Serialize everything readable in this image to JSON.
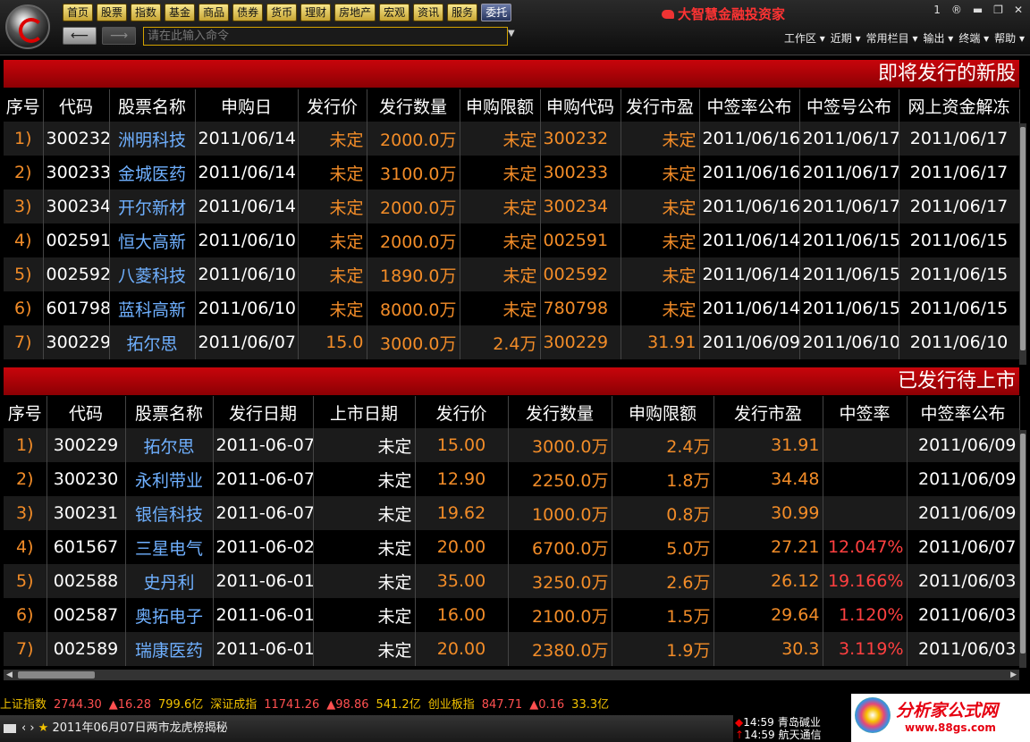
{
  "menubar": {
    "items": [
      "首页",
      "股票",
      "指数",
      "基金",
      "商品",
      "债券",
      "货币",
      "理财",
      "房地产",
      "宏观",
      "资讯",
      "服务",
      "委托"
    ],
    "selected_index": 12
  },
  "brand": "大智慧金融投资家",
  "window": {
    "pin": "1",
    "reg": "®",
    "min": "▬",
    "max": "❐",
    "close": "✕"
  },
  "nav": {
    "back": "⟵",
    "forward": "⟶"
  },
  "command": {
    "placeholder": "请在此输入命令",
    "dropdown": "▼"
  },
  "right_menu": [
    "工作区 ▾",
    "近期 ▾",
    "常用栏目 ▾",
    "输出 ▾",
    "终端 ▾",
    "帮助 ▾"
  ],
  "section1": {
    "title": "即将发行的新股",
    "headers": [
      "序号",
      "代码",
      "股票名称",
      "申购日",
      "发行价",
      "发行数量",
      "申购限额",
      "申购代码",
      "发行市盈",
      "中签率公布",
      "中签号公布",
      "网上资金解冻"
    ],
    "rows": [
      [
        "1)",
        "300232",
        "洲明科技",
        "2011/06/14",
        "未定",
        "2000.0万",
        "未定",
        "300232",
        "未定",
        "2011/06/16",
        "2011/06/17",
        "2011/06/17"
      ],
      [
        "2)",
        "300233",
        "金城医药",
        "2011/06/14",
        "未定",
        "3100.0万",
        "未定",
        "300233",
        "未定",
        "2011/06/16",
        "2011/06/17",
        "2011/06/17"
      ],
      [
        "3)",
        "300234",
        "开尔新材",
        "2011/06/14",
        "未定",
        "2000.0万",
        "未定",
        "300234",
        "未定",
        "2011/06/16",
        "2011/06/17",
        "2011/06/17"
      ],
      [
        "4)",
        "002591",
        "恒大高新",
        "2011/06/10",
        "未定",
        "2000.0万",
        "未定",
        "002591",
        "未定",
        "2011/06/14",
        "2011/06/15",
        "2011/06/15"
      ],
      [
        "5)",
        "002592",
        "八菱科技",
        "2011/06/10",
        "未定",
        "1890.0万",
        "未定",
        "002592",
        "未定",
        "2011/06/14",
        "2011/06/15",
        "2011/06/15"
      ],
      [
        "6)",
        "601798",
        "蓝科高新",
        "2011/06/10",
        "未定",
        "8000.0万",
        "未定",
        "780798",
        "未定",
        "2011/06/14",
        "2011/06/15",
        "2011/06/15"
      ],
      [
        "7)",
        "300229",
        "拓尔思",
        "2011/06/07",
        "15.0",
        "3000.0万",
        "2.4万",
        "300229",
        "31.91",
        "2011/06/09",
        "2011/06/10",
        "2011/06/10"
      ]
    ]
  },
  "section2": {
    "title": "已发行待上市",
    "headers": [
      "序号",
      "代码",
      "股票名称",
      "发行日期",
      "上市日期",
      "发行价",
      "发行数量",
      "申购限额",
      "发行市盈",
      "中签率",
      "中签率公布"
    ],
    "rows": [
      [
        "1)",
        "300229",
        "拓尔思",
        "2011-06-07",
        "未定",
        "15.00",
        "3000.0万",
        "2.4万",
        "31.91",
        "",
        "2011/06/09"
      ],
      [
        "2)",
        "300230",
        "永利带业",
        "2011-06-07",
        "未定",
        "12.90",
        "2250.0万",
        "1.8万",
        "34.48",
        "",
        "2011/06/09"
      ],
      [
        "3)",
        "300231",
        "银信科技",
        "2011-06-07",
        "未定",
        "19.62",
        "1000.0万",
        "0.8万",
        "30.99",
        "",
        "2011/06/09"
      ],
      [
        "4)",
        "601567",
        "三星电气",
        "2011-06-02",
        "未定",
        "20.00",
        "6700.0万",
        "5.0万",
        "27.21",
        "12.047%",
        "2011/06/07"
      ],
      [
        "5)",
        "002588",
        "史丹利",
        "2011-06-01",
        "未定",
        "35.00",
        "3250.0万",
        "2.6万",
        "26.12",
        "19.166%",
        "2011/06/03"
      ],
      [
        "6)",
        "002587",
        "奥拓电子",
        "2011-06-01",
        "未定",
        "16.00",
        "2100.0万",
        "1.5万",
        "29.64",
        "1.120%",
        "2011/06/03"
      ],
      [
        "7)",
        "002589",
        "瑞康医药",
        "2011-06-01",
        "未定",
        "20.00",
        "2380.0万",
        "1.9万",
        "30.3",
        "3.119%",
        "2011/06/03"
      ]
    ]
  },
  "ticker": [
    {
      "name": "上证指数",
      "value": "2744.30",
      "change": "▲16.28",
      "amount": "799.6亿"
    },
    {
      "name": "深证成指",
      "value": "11741.26",
      "change": "▲98.86",
      "amount": "541.2亿"
    },
    {
      "name": "创业板指",
      "value": "847.71",
      "change": "▲0.16",
      "amount": "33.3亿"
    }
  ],
  "news": {
    "arrows": "‹ ›",
    "star": "★",
    "text": "2011年06月07日两市龙虎榜揭秘"
  },
  "alerts": [
    {
      "marker": "◆",
      "time": "14:59",
      "name": "青岛碱业"
    },
    {
      "marker": "↑",
      "time": "14:59",
      "name": "航天通信"
    }
  ],
  "footer_logo": {
    "title": "分析家公式网",
    "url": "www.88gs.com"
  },
  "colors": {
    "band": "#c8050b",
    "orange": "#f28c28",
    "blue": "#6fb0ff",
    "red": "#ff4040",
    "gold": "#d3a200"
  }
}
